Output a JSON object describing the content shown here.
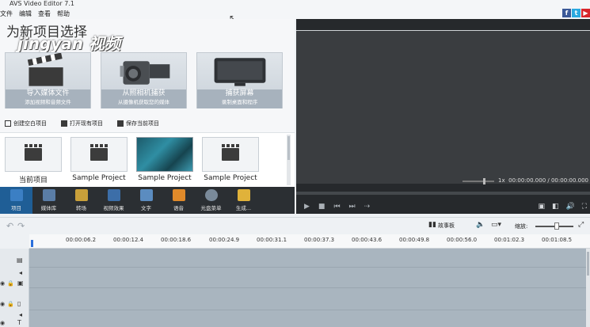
{
  "app": {
    "title": "AVS Video Editor 7.1",
    "menu": [
      "文件",
      "编辑",
      "查看",
      "帮助"
    ],
    "social": [
      {
        "name": "facebook",
        "glyph": "f",
        "color": "#3b5998"
      },
      {
        "name": "twitter",
        "glyph": "t",
        "color": "#2aa9e0"
      },
      {
        "name": "youtube",
        "glyph": "▶",
        "color": "#d8262c"
      }
    ]
  },
  "start_panel": {
    "title": "为新项目选择",
    "watermark": "jingyan 视频",
    "tiles": [
      {
        "title": "导入媒体文件",
        "subtitle": "添加视频和音频文件",
        "icon": "clapperboard-icon"
      },
      {
        "title": "从照相机捕获",
        "subtitle": "从摄像机获取您的媒体",
        "icon": "camera-icon"
      },
      {
        "title": "捕获屏幕",
        "subtitle": "录制桌面和程序",
        "icon": "monitor-icon"
      }
    ],
    "actions": [
      "创建空白项目",
      "打开现有项目",
      "保存当前项目"
    ],
    "recent": [
      {
        "label": "当前项目",
        "kind": "clapper"
      },
      {
        "label": "Sample Project",
        "kind": "clapper"
      },
      {
        "label": "Sample Project",
        "kind": "photo"
      },
      {
        "label": "Sample Project",
        "kind": "clapper"
      }
    ]
  },
  "toolbar": [
    {
      "label": "项目",
      "icon": "project-icon",
      "color": "#3b7fc4",
      "active": true
    },
    {
      "label": "媒体库",
      "icon": "media-library-icon",
      "color": "#5a7da6",
      "active": false
    },
    {
      "label": "转场",
      "icon": "transitions-icon",
      "color": "#c9a03a",
      "active": false
    },
    {
      "label": "视频效果",
      "icon": "video-effects-icon",
      "color": "#3c6ea8",
      "active": false
    },
    {
      "label": "文字",
      "icon": "text-icon",
      "color": "#5b8cc0",
      "active": false
    },
    {
      "label": "语音",
      "icon": "voice-icon",
      "color": "#e08a2a",
      "active": false
    },
    {
      "label": "光盘菜单",
      "icon": "disc-menu-icon",
      "color": "#7a8a9a",
      "active": false
    },
    {
      "label": "生成...",
      "icon": "produce-icon",
      "color": "#e0b23a",
      "active": false
    }
  ],
  "preview": {
    "speed": "1x",
    "time": "00:00:00.000 / 00:00:00.000"
  },
  "timeline": {
    "storyboard_label": "故事板",
    "zoom_label": "缩放:",
    "ruler": [
      "00:00:06.2",
      "00:00:12.4",
      "00:00:18.6",
      "00:00:24.9",
      "00:00:31.1",
      "00:00:37.3",
      "00:00:43.6",
      "00:00:49.8",
      "00:00:56.0",
      "00:01:02.3",
      "00:01:08.5"
    ]
  }
}
